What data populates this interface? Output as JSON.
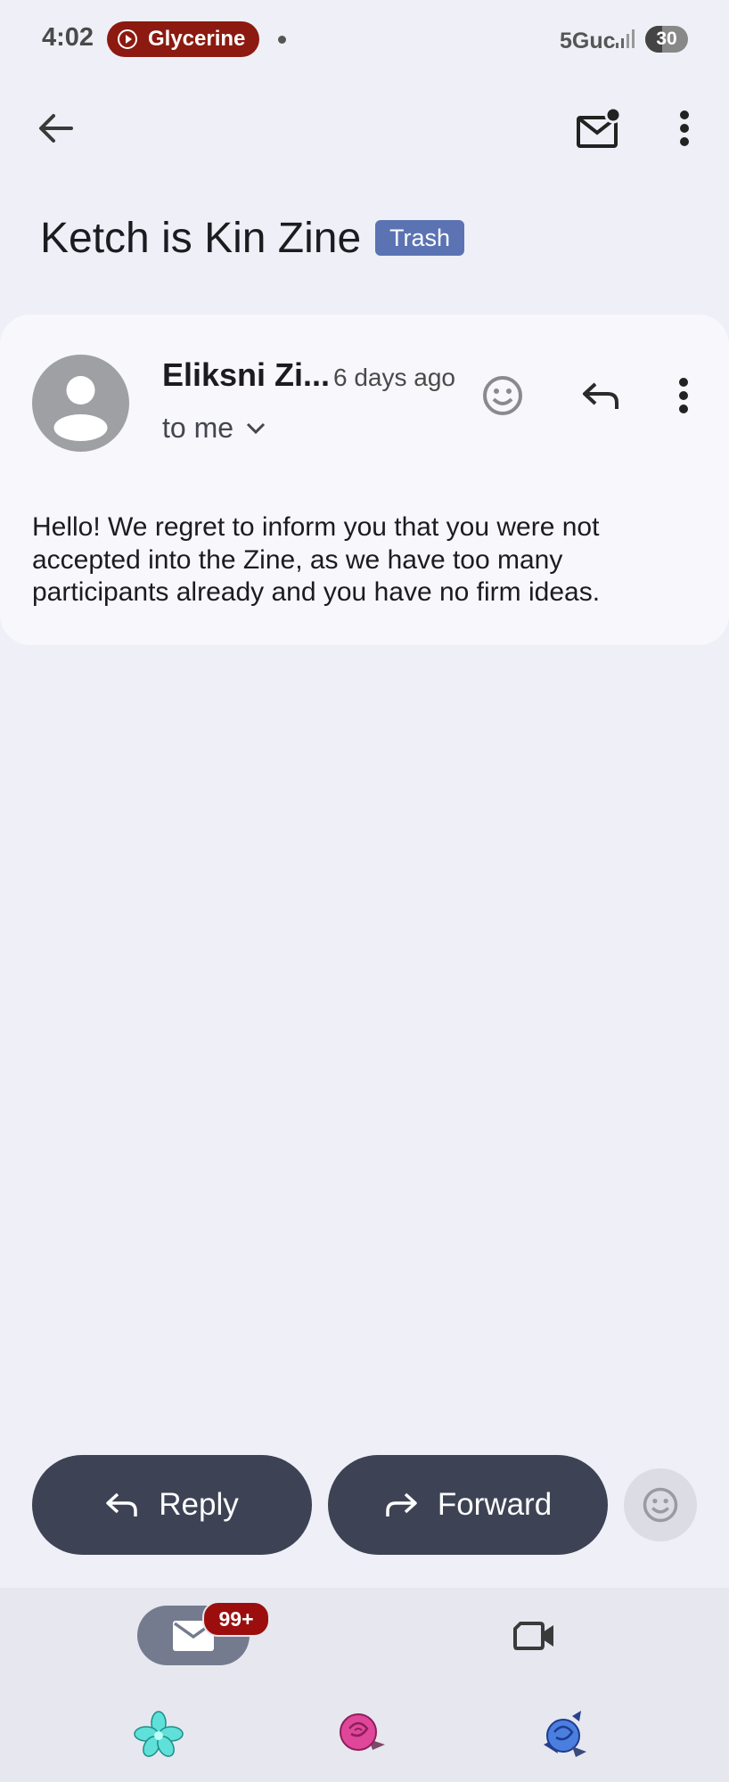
{
  "status_bar": {
    "time": "4:02",
    "recording_app": "Glycerine",
    "network": "5Guc",
    "battery": "30"
  },
  "toolbar": {
    "back_icon": "arrow-left-icon",
    "unread_icon": "mark-unread-icon",
    "more_icon": "more-vert-icon"
  },
  "email": {
    "subject": "Ketch is Kin Zine",
    "label": "Trash",
    "sender": "Eliksni Zi...",
    "time_ago": "6 days ago",
    "recipient": "to me",
    "body": "Hello! We regret to inform you that you were not accepted into the Zine, as we have too many participants already and you have no firm ideas."
  },
  "actions": {
    "reply_label": "Reply",
    "forward_label": "Forward"
  },
  "nav": {
    "mail_badge": "99+"
  },
  "colors": {
    "background": "#efeff7",
    "card": "#f7f7fc",
    "label_trash": "#5b73b3",
    "pill_button": "#3d4354",
    "badge": "#9c0e0e",
    "recording": "#8c1a10"
  }
}
